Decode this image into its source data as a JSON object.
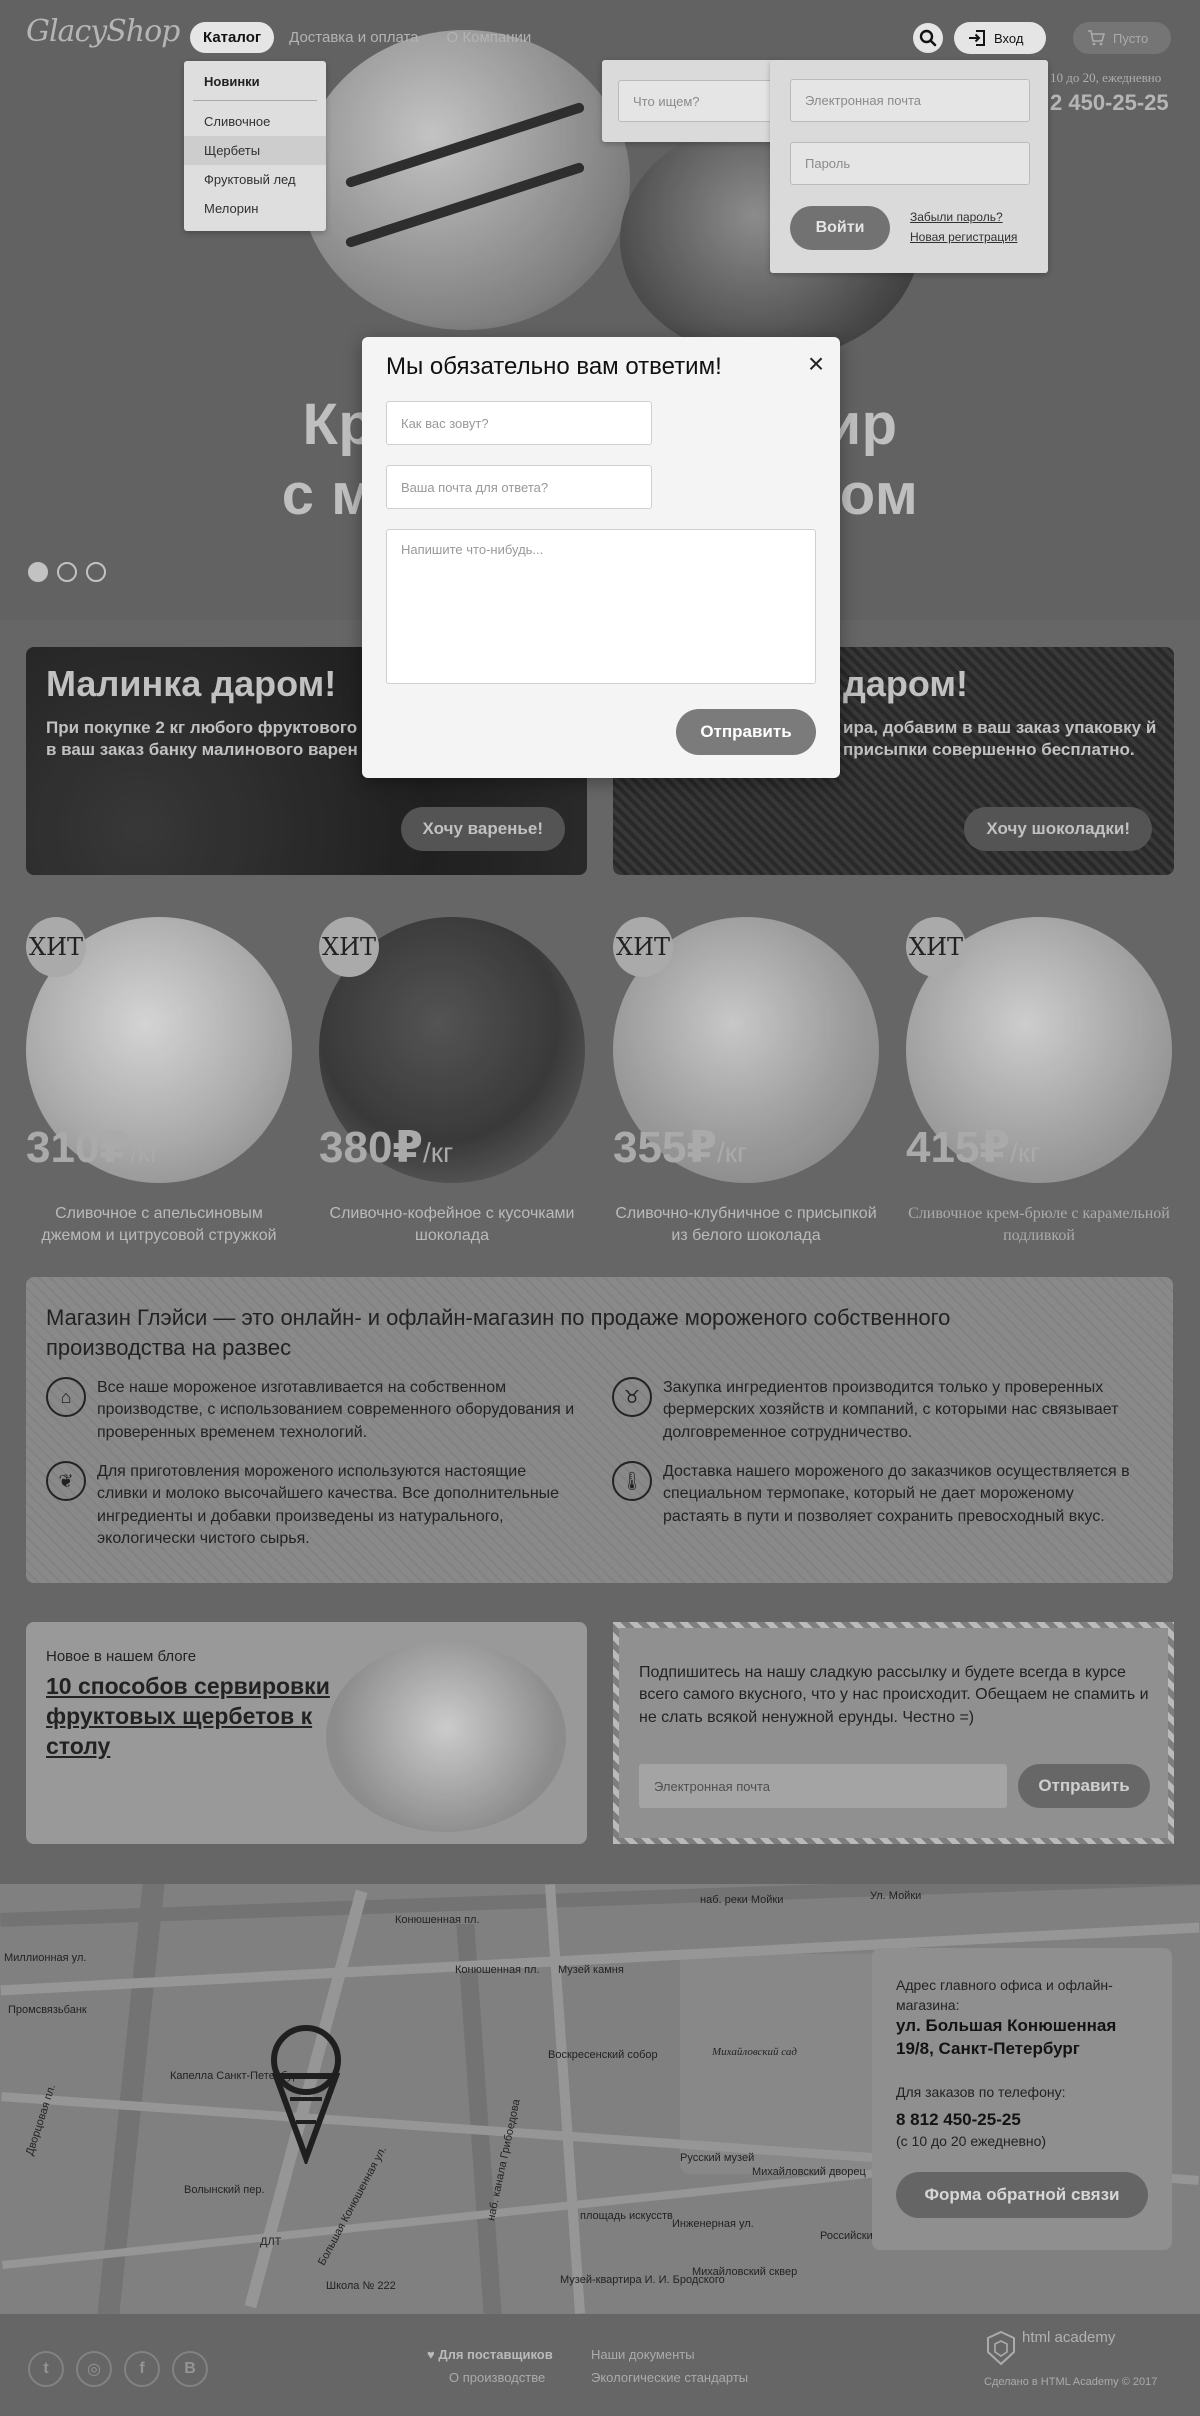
{
  "header": {
    "logo": "GlacyShop",
    "nav": [
      "Каталог",
      "Доставка и оплата",
      "О Компании"
    ],
    "login_label": "Вход",
    "cart_label": "Пусто",
    "hours": "10 до 20, ежедневно",
    "phone": "2 450-25-25"
  },
  "catalog_menu": {
    "items": [
      "Новинки",
      "Сливочное",
      "Щербеты",
      "Фруктовый лед",
      "Мелорин"
    ]
  },
  "search": {
    "placeholder": "Что ищем?"
  },
  "login": {
    "email_placeholder": "Электронная почта",
    "password_placeholder": "Пароль",
    "submit": "Войти",
    "forgot": "Забыли пароль?",
    "register": "Новая регистрация"
  },
  "hero": {
    "title_line1": "Кре                       бир",
    "title_line2": "с м                            ом",
    "slides": 3,
    "active_slide": 0
  },
  "promos": [
    {
      "title": "Малинка даром!",
      "text": "При покупке 2 кг любого фруктового\nв ваш заказ банку малинового варен",
      "button": "Хочу варенье!"
    },
    {
      "title": "даром!",
      "text": "ира, добавим в ваш заказ упаковку\nй присыпки совершенно бесплатно.",
      "button": "Хочу шоколадки!"
    }
  ],
  "products": [
    {
      "badge": "ХИТ",
      "price": "310₽",
      "unit": "/кг",
      "desc": "Сливочное с апельсиновым джемом и цитрусовой стружкой"
    },
    {
      "badge": "ХИТ",
      "price": "380₽",
      "unit": "/кг",
      "desc": "Сливочно-кофейное с кусочками шоколада"
    },
    {
      "badge": "ХИТ",
      "price": "355₽",
      "unit": "/кг",
      "desc": "Сливочно-клубничное с присыпкой из белого шоколада"
    },
    {
      "badge": "ХИТ",
      "price": "415₽",
      "unit": "/кг",
      "desc": "Сливочное крем-брюле с карамельной подливкой"
    }
  ],
  "about": {
    "title": "Магазин Глэйси — это онлайн- и офлайн-магазин по продаже мороженого собственного производства на развес",
    "features": [
      "Все наше мороженое изготавливается на собственном производстве, с использованием современного оборудования и проверенных временем технологий.",
      "Закупка ингредиентов  производится только у проверенных фермерских хозяйств и компаний, с которыми нас связывает долговременное сотрудничество.",
      "Для приготовления мороженого используются настоящие сливки и молоко высочайшего качества. Все дополнительные ингредиенты и добавки произведены из натурального, экологически чистого сырья.",
      "Доставка нашего мороженого до заказчиков осуществляется в специальном термопаке, который не дает мороженому растаять в пути и позволяет сохранить превосходный вкус."
    ]
  },
  "blog": {
    "label": "Новое в нашем блоге",
    "title": "10 способов сервировки фруктовых щербетов к столу"
  },
  "subscribe": {
    "text": "Подпишитесь на нашу сладкую рассылку и будете всегда в курсе всего самого вкусного, что у нас происходит. Обещаем не спамить и не слать всякой ненужной ерунды. Честно =)",
    "placeholder": "Электронная почта",
    "button": "Отправить"
  },
  "map_labels": [
    "наб. реки Мойки",
    "Конюшенная пл.",
    "Конюшенная пл.",
    "Музей камня",
    "Миллионная ул.",
    "Промсвязьбанк",
    "Капелла Санкт-Петербурга",
    "Воскресенский собор",
    "Михайловский сад",
    "Русский музей",
    "Михайловский дворец",
    "Волынский пер.",
    "площадь искусств",
    "Инженерная ул.",
    "Российский этнографический музей",
    "Школа № 222",
    "Музей-квартира И. И. Бродского",
    "Михайловский сквер",
    "Большая Конюшенная ул.",
    "наб. канала Грибоедова",
    "ДЛТ",
    "Дворцовая пл.",
    "Ул. Мойки"
  ],
  "address": {
    "label": "Адрес главного офиса и офлайн-магазина:",
    "street": "ул. Большая Конюшенная 19/8, Санкт-Петербург",
    "phone_label": "Для заказов по телефону:",
    "phone": "8 812 450-25-25",
    "hours": "(с 10 до 20 ежедневно)",
    "button": "Форма обратной связи"
  },
  "footer": {
    "social": [
      "t",
      "◎",
      "f",
      "B"
    ],
    "links": [
      "Для поставщиков",
      "О производстве",
      "Наши документы",
      "Экологические стандарты"
    ],
    "academy": "html academy",
    "credit": "Сделано в HTML Academy © 2017"
  },
  "modal": {
    "title": "Мы обязательно вам ответим!",
    "name_placeholder": "Как вас зовут?",
    "email_placeholder": "Ваша почта для ответа?",
    "message_placeholder": "Напишите что-нибудь...",
    "submit": "Отправить"
  }
}
